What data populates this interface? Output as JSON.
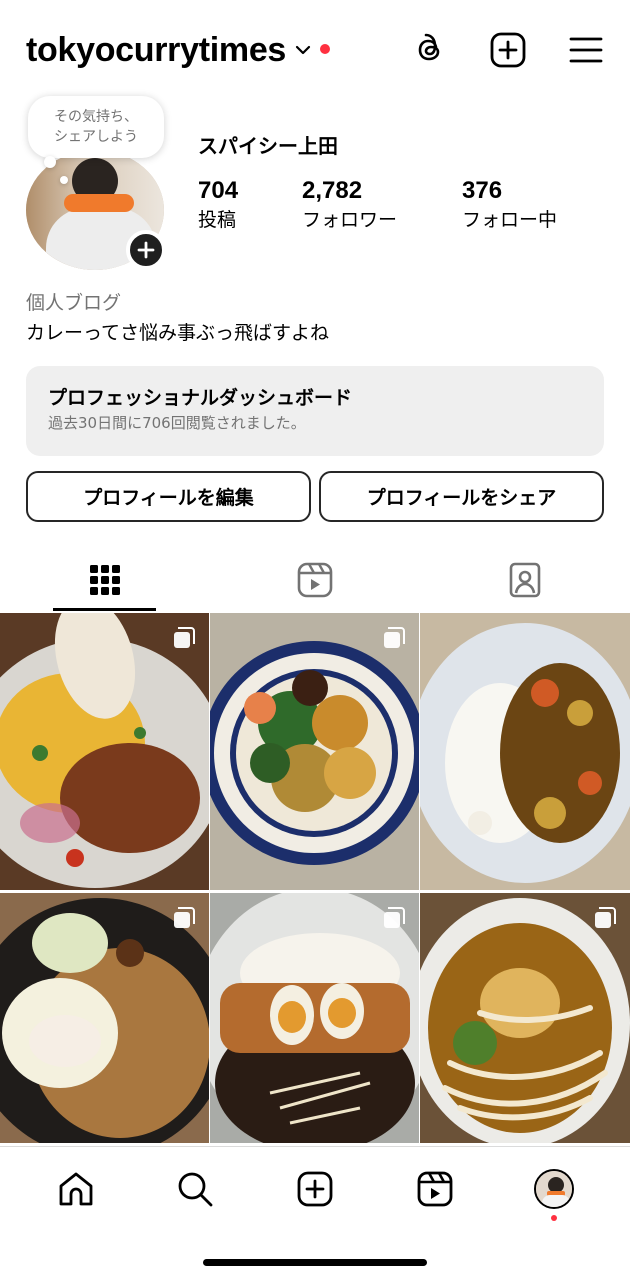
{
  "header": {
    "username": "tokyocurrytimes",
    "icons": [
      "threads-icon",
      "new-post-icon",
      "menu-icon"
    ],
    "notification_dot_color": "#ff3040"
  },
  "profile": {
    "note_line1": "その気持ち、",
    "note_line2": "シェアしよう",
    "display_name": "スパイシー上田",
    "stats": [
      {
        "value": "704",
        "label": "投稿"
      },
      {
        "value": "2,782",
        "label": "フォロワー"
      },
      {
        "value": "376",
        "label": "フォロー中"
      }
    ],
    "category": "個人ブログ",
    "bio": "カレーってさ悩み事ぶっ飛ばすよね"
  },
  "dashboard": {
    "title": "プロフェッショナルダッシュボード",
    "subtitle": "過去30日間に706回閲覧されました。"
  },
  "buttons": {
    "edit_profile": "プロフィールを編集",
    "share_profile": "プロフィールをシェア"
  },
  "tabs": [
    "grid-icon",
    "reels-icon",
    "tagged-icon"
  ],
  "grid": {
    "posts": [
      {
        "name": "keema-curry-with-turmeric-rice",
        "multi": true
      },
      {
        "name": "spice-curry-plate-blue-rim",
        "multi": true
      },
      {
        "name": "japanese-beef-curry-rice",
        "multi": false
      },
      {
        "name": "curry-with-egg-and-cabbage",
        "multi": true
      },
      {
        "name": "katsu-curry-with-eggs",
        "multi": true
      },
      {
        "name": "curry-udon",
        "multi": true
      }
    ]
  },
  "bottom_nav": {
    "items": [
      "home-icon",
      "search-icon",
      "create-icon",
      "reels-icon",
      "profile-avatar"
    ]
  }
}
